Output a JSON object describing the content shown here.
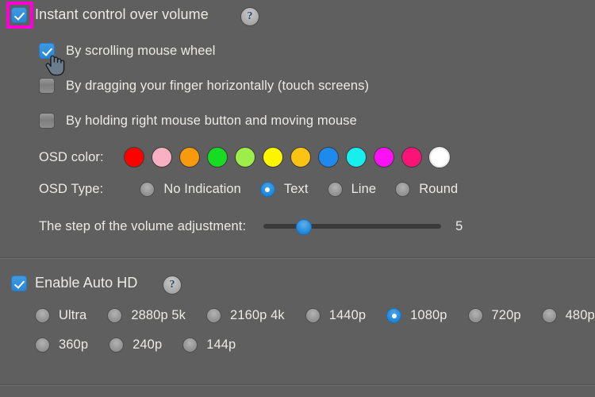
{
  "volume_section": {
    "master": {
      "label": "Instant control over volume",
      "checked": true,
      "help_glyph": "?"
    },
    "options": [
      {
        "label": "By scrolling mouse wheel",
        "checked": true
      },
      {
        "label": "By dragging your finger horizontally (touch screens)",
        "checked": false
      },
      {
        "label": "By holding right mouse button and moving mouse",
        "checked": false
      }
    ],
    "osd_color": {
      "label": "OSD color:",
      "selected_index": 11,
      "swatches": [
        {
          "name": "red",
          "hex": "#fe0000"
        },
        {
          "name": "pink",
          "hex": "#f9b0c3"
        },
        {
          "name": "orange",
          "hex": "#f79b0c"
        },
        {
          "name": "green",
          "hex": "#16dd22"
        },
        {
          "name": "light-green",
          "hex": "#9ded4b"
        },
        {
          "name": "yellow",
          "hex": "#fdf400"
        },
        {
          "name": "gold",
          "hex": "#fcc412"
        },
        {
          "name": "blue",
          "hex": "#1f8aee"
        },
        {
          "name": "cyan",
          "hex": "#17efef"
        },
        {
          "name": "magenta",
          "hex": "#fa12f4"
        },
        {
          "name": "hot-pink",
          "hex": "#fb1477"
        },
        {
          "name": "white",
          "hex": "#ffffff"
        }
      ]
    },
    "osd_type": {
      "label": "OSD Type:",
      "selected": "Text",
      "options": [
        "No Indication",
        "Text",
        "Line",
        "Round"
      ]
    },
    "volume_step": {
      "label": "The step of the volume adjustment:",
      "value": "5",
      "min": 1,
      "max": 20,
      "fill_percent": 20
    }
  },
  "auto_hd_section": {
    "master": {
      "label": "Enable Auto HD",
      "checked": true,
      "help_glyph": "?"
    },
    "selected": "1080p",
    "qualities": [
      "Ultra",
      "2880p 5k",
      "2160p 4k",
      "1440p",
      "1080p",
      "720p",
      "480p",
      "360p",
      "240p",
      "144p"
    ]
  },
  "annotation": {
    "focus_highlight_color": "#ff00d4",
    "focus_target": "instant-control-over-volume-checkbox"
  },
  "theme": {
    "background": "#5f5f5f",
    "text": "#eceae6",
    "accent": "#1f86db"
  }
}
